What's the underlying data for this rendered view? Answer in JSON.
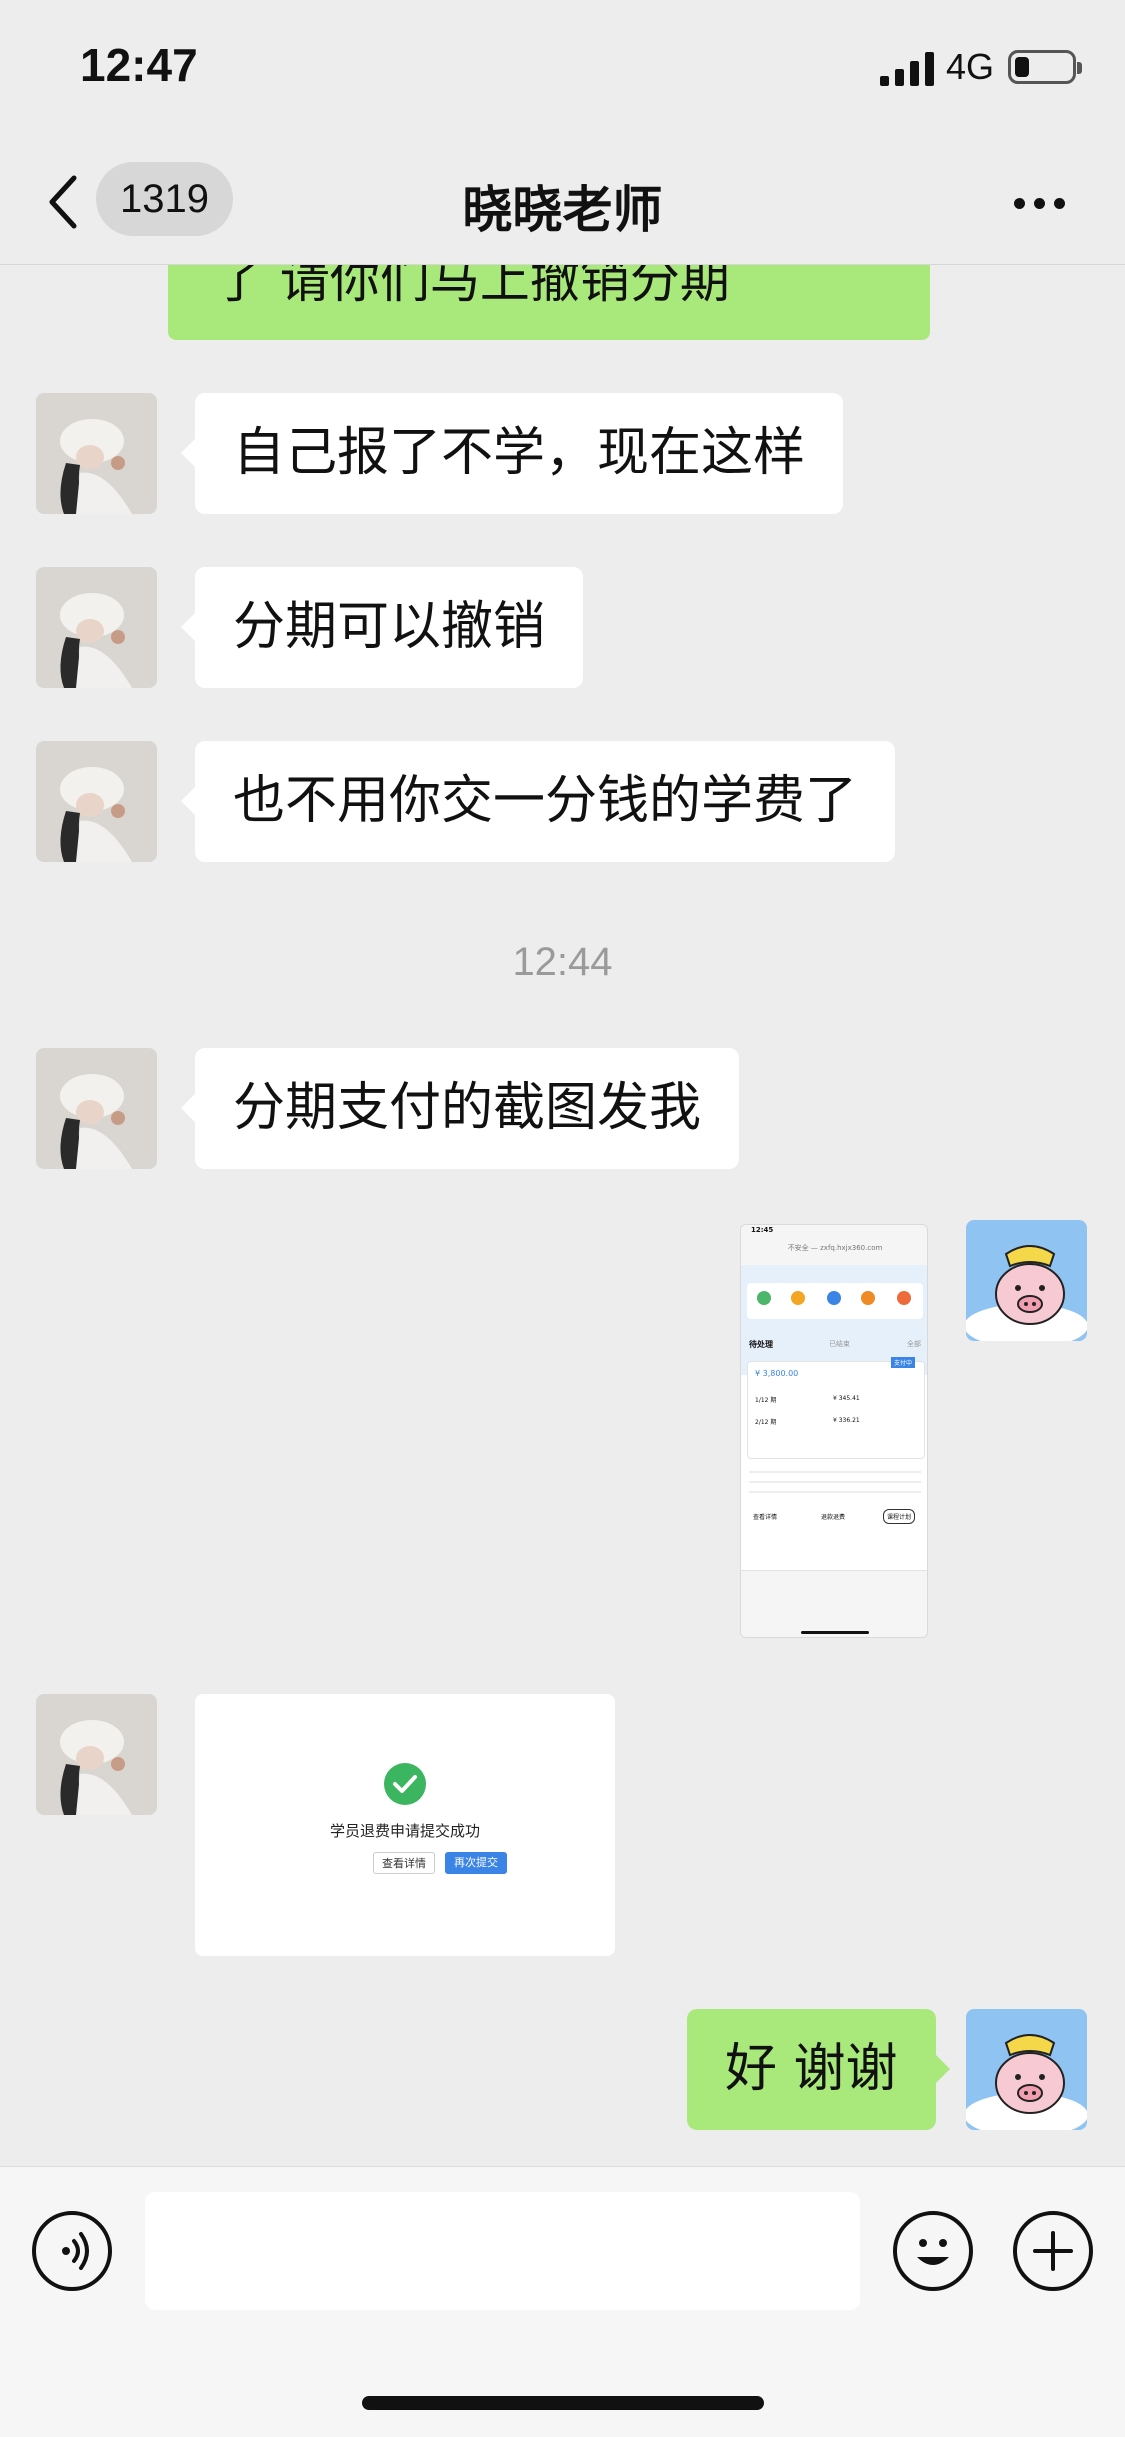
{
  "status": {
    "time": "12:47",
    "network": "4G",
    "battery_level": 0.25
  },
  "nav": {
    "unread_count": "1319",
    "title": "晓晓老师"
  },
  "messages": {
    "partial_top": "了 请你们马上撤销分期",
    "m1": "自己报了不学，现在这样",
    "m2": "分期可以撤销",
    "m3": "也不用你交一分钱的学费了",
    "time": "12:44",
    "m4": "分期支付的截图发我",
    "card_title": "学员退费申请提交成功",
    "card_btn_details": "查看详情",
    "card_btn_resubmit": "再次提交",
    "m5": "好 谢谢"
  },
  "screenshot_thumb": {
    "time": "12:45",
    "url": "不安全 — zxfq.hxjx360.com",
    "tab_pending": "待处理",
    "tab_done": "已结束",
    "tab_all": "全部",
    "status_tag": "支付中",
    "amount": "¥ 3,800.00",
    "row1_period": "1/12 期",
    "row1_amount": "¥ 345.41",
    "row2_period": "2/12 期",
    "row2_amount": "¥ 336.21",
    "btn_view": "查看详情",
    "btn_refund": "退款退费",
    "btn_plan": "课程计划"
  },
  "colors": {
    "background": "#ededed",
    "sent_bubble": "#a9e97c",
    "received_bubble": "#ffffff",
    "accent_blue": "#3a84e6",
    "check_green": "#3bb55f"
  },
  "icons": [
    "back-arrow-icon",
    "more-dots-icon",
    "voice-icon",
    "emoji-icon",
    "plus-icon"
  ],
  "input": {
    "value": ""
  }
}
